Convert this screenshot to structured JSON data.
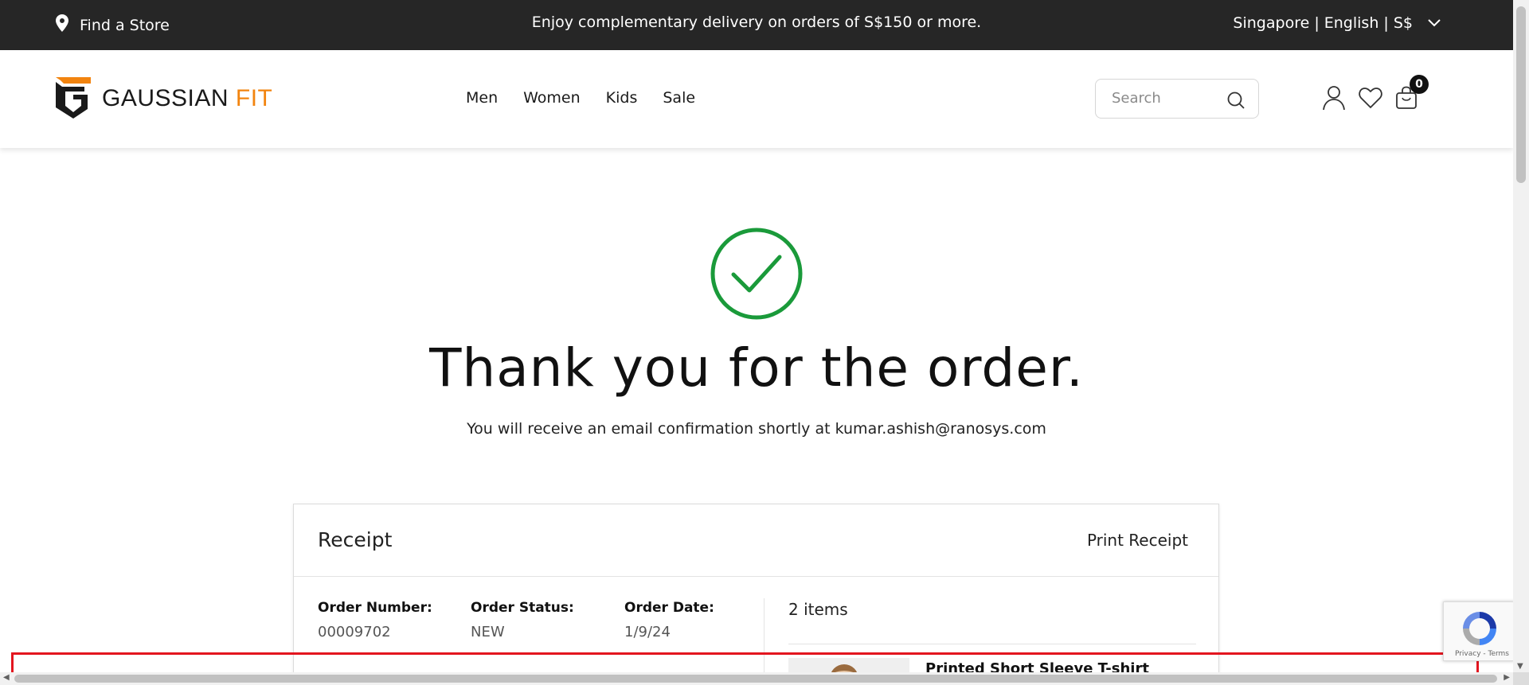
{
  "topbar": {
    "store_label": "Find a Store",
    "promo_text": "Enjoy complementary delivery on orders of S$150 or more.",
    "locale_text": "Singapore | English | S$"
  },
  "header": {
    "logo_part1": "GAUSSIAN",
    "logo_part2": "FIT",
    "nav": [
      "Men",
      "Women",
      "Kids",
      "Sale"
    ],
    "search_placeholder": "Search",
    "cart_count": "0"
  },
  "confirmation": {
    "title": "Thank you for the order.",
    "message": "You will receive an email confirmation shortly at kumar.ashish@ranosys.com"
  },
  "receipt": {
    "title": "Receipt",
    "print_label": "Print Receipt",
    "order_number_label": "Order Number:",
    "order_number": "00009702",
    "order_status_label": "Order Status:",
    "order_status": "NEW",
    "order_date_label": "Order Date:",
    "order_date": "1/9/24",
    "items_count": "2 items",
    "first_item_name": "Printed Short Sleeve T-shirt"
  },
  "recaptcha": {
    "links": "Privacy - Terms"
  },
  "colors": {
    "topbar_bg": "#262626",
    "brand_orange": "#f2840f",
    "success_green": "#1a9a3a",
    "highlight_red": "#e3151f"
  }
}
